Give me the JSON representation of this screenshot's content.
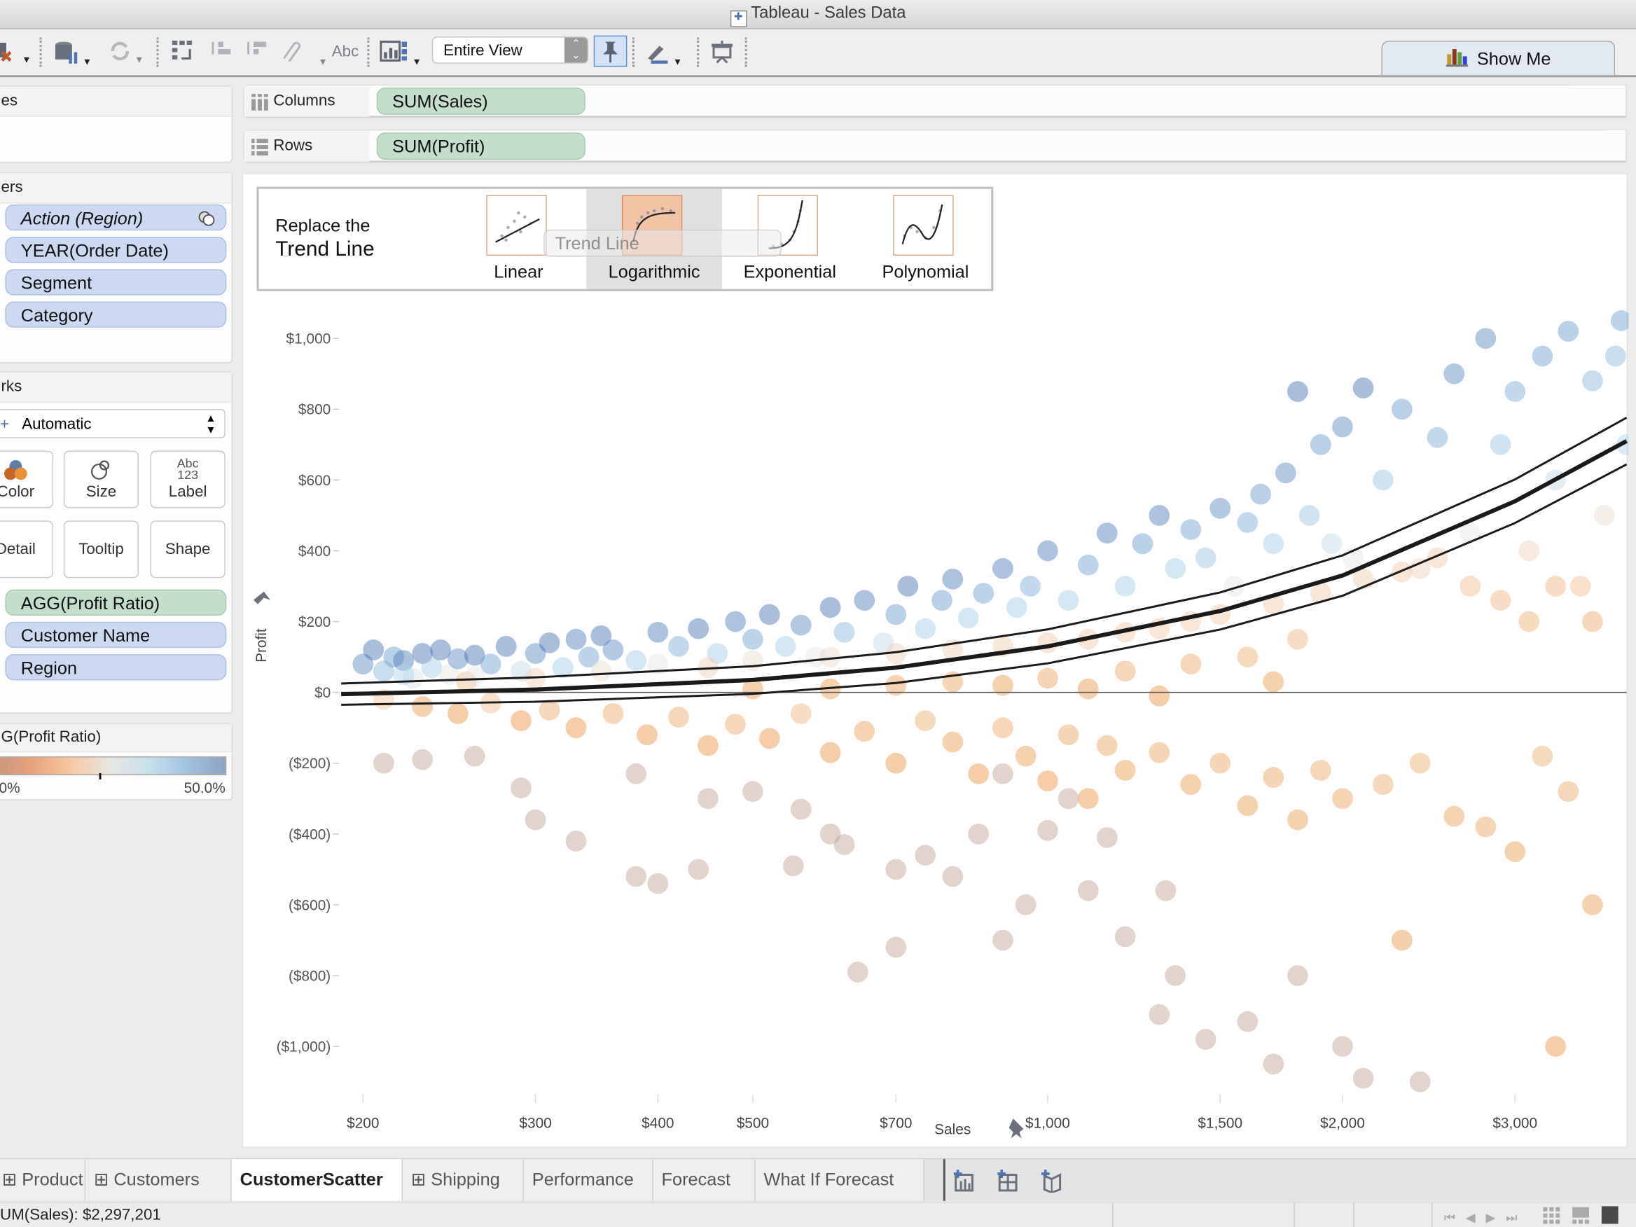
{
  "window": {
    "title": "Tableau - Sales Data"
  },
  "toolbar": {
    "fit_value": "Entire View",
    "label_button": "Abc",
    "show_me": "Show Me",
    "icons": [
      "clear-sheet-icon",
      "data-source-icon",
      "refresh-icon",
      "swap-axes-icon",
      "sort-ascending-icon",
      "sort-descending-icon",
      "group-icon",
      "show-labels-icon",
      "chart-type-icon",
      "pin-axis-icon",
      "highlight-pen-icon",
      "presentation-icon"
    ]
  },
  "panels": {
    "pages": {
      "title": "es"
    },
    "filters": {
      "title": "ers",
      "items": [
        "Action (Region)",
        "YEAR(Order Date)",
        "Segment",
        "Category"
      ]
    },
    "marks": {
      "title": "rks",
      "mark_type": "Automatic",
      "buttons": [
        "Color",
        "Size",
        "Label",
        "Detail",
        "Tooltip",
        "Shape"
      ],
      "label_glyph_top": "Abc",
      "label_glyph_bottom": "123",
      "fields": [
        {
          "label": "AGG(Profit Ratio)",
          "kind": "measure"
        },
        {
          "label": "Customer Name",
          "kind": "dimension"
        },
        {
          "label": "Region",
          "kind": "dimension"
        }
      ]
    },
    "legend": {
      "title": "G(Profit Ratio)",
      "min_label": "0%",
      "max_label": "50.0%",
      "colors": [
        "#c89680",
        "#e8a57a",
        "#f6caa4",
        "#e8e6e2",
        "#c6e1ee",
        "#9fc3e0",
        "#8ea3c3"
      ]
    }
  },
  "shelves": {
    "columns": {
      "label": "Columns",
      "pill": "SUM(Sales)"
    },
    "rows": {
      "label": "Rows",
      "pill": "SUM(Profit)"
    }
  },
  "trend_popup": {
    "title_line1": "Replace the",
    "title_line2": "Trend Line",
    "drag_label": "Trend Line",
    "options": [
      {
        "label": "Linear",
        "selected": false
      },
      {
        "label": "Logarithmic",
        "selected": true
      },
      {
        "label": "Exponential",
        "selected": false
      },
      {
        "label": "Polynomial",
        "selected": false
      }
    ]
  },
  "chart_data": {
    "type": "scatter",
    "title": "",
    "xlabel": "Sales",
    "ylabel": "Profit",
    "x_scale": "log",
    "xlim": [
      190,
      3900
    ],
    "ylim": [
      -1130,
      1110
    ],
    "x_ticks": [
      {
        "value": 200,
        "label": "$200"
      },
      {
        "value": 300,
        "label": "$300"
      },
      {
        "value": 400,
        "label": "$400"
      },
      {
        "value": 500,
        "label": "$500"
      },
      {
        "value": 700,
        "label": "$700"
      },
      {
        "value": 1000,
        "label": "$1,000"
      },
      {
        "value": 1500,
        "label": "$1,500"
      },
      {
        "value": 2000,
        "label": "$2,000"
      },
      {
        "value": 3000,
        "label": "$3,000"
      }
    ],
    "y_ticks": [
      {
        "value": 1000,
        "label": "$1,000"
      },
      {
        "value": 800,
        "label": "$800"
      },
      {
        "value": 600,
        "label": "$600"
      },
      {
        "value": 400,
        "label": "$400"
      },
      {
        "value": 200,
        "label": "$200"
      },
      {
        "value": 0,
        "label": "$0"
      },
      {
        "value": -200,
        "label": "($200)"
      },
      {
        "value": -400,
        "label": "($400)"
      },
      {
        "value": -600,
        "label": "($600)"
      },
      {
        "value": -800,
        "label": "($800)"
      },
      {
        "value": -1000,
        "label": "($1,000)"
      }
    ],
    "color_field": "AGG(Profit Ratio)",
    "color_range": [
      0,
      0.5
    ],
    "trend_line": {
      "model": "exponential-like",
      "points": [
        [
          190,
          -5
        ],
        [
          300,
          8
        ],
        [
          500,
          35
        ],
        [
          700,
          70
        ],
        [
          1000,
          130
        ],
        [
          1500,
          230
        ],
        [
          2000,
          330
        ],
        [
          3000,
          540
        ],
        [
          3900,
          710
        ]
      ],
      "band": 30
    },
    "points": [
      [
        200,
        80,
        0.45
      ],
      [
        205,
        120,
        0.5
      ],
      [
        210,
        60,
        0.35
      ],
      [
        215,
        100,
        0.42
      ],
      [
        220,
        90,
        0.48
      ],
      [
        225,
        40,
        0.22
      ],
      [
        230,
        110,
        0.5
      ],
      [
        235,
        70,
        0.3
      ],
      [
        240,
        120,
        0.5
      ],
      [
        245,
        50,
        0.2
      ],
      [
        250,
        95,
        0.45
      ],
      [
        255,
        30,
        0.1
      ],
      [
        260,
        105,
        0.5
      ],
      [
        270,
        80,
        0.4
      ],
      [
        280,
        130,
        0.5
      ],
      [
        290,
        60,
        0.25
      ],
      [
        300,
        110,
        0.45
      ],
      [
        310,
        140,
        0.5
      ],
      [
        320,
        70,
        0.3
      ],
      [
        330,
        150,
        0.48
      ],
      [
        340,
        100,
        0.4
      ],
      [
        350,
        160,
        0.5
      ],
      [
        360,
        120,
        0.45
      ],
      [
        380,
        90,
        0.3
      ],
      [
        400,
        170,
        0.48
      ],
      [
        420,
        130,
        0.38
      ],
      [
        440,
        180,
        0.5
      ],
      [
        460,
        110,
        0.3
      ],
      [
        480,
        200,
        0.48
      ],
      [
        500,
        150,
        0.4
      ],
      [
        520,
        220,
        0.5
      ],
      [
        540,
        130,
        0.3
      ],
      [
        560,
        190,
        0.45
      ],
      [
        580,
        100,
        0.2
      ],
      [
        600,
        240,
        0.5
      ],
      [
        620,
        170,
        0.35
      ],
      [
        650,
        260,
        0.48
      ],
      [
        680,
        140,
        0.25
      ],
      [
        700,
        220,
        0.42
      ],
      [
        720,
        300,
        0.5
      ],
      [
        750,
        180,
        0.3
      ],
      [
        780,
        260,
        0.42
      ],
      [
        800,
        320,
        0.48
      ],
      [
        830,
        210,
        0.3
      ],
      [
        860,
        280,
        0.4
      ],
      [
        900,
        350,
        0.48
      ],
      [
        930,
        240,
        0.3
      ],
      [
        960,
        300,
        0.38
      ],
      [
        1000,
        400,
        0.48
      ],
      [
        1050,
        260,
        0.3
      ],
      [
        1100,
        360,
        0.4
      ],
      [
        1150,
        450,
        0.48
      ],
      [
        1200,
        300,
        0.3
      ],
      [
        1250,
        420,
        0.42
      ],
      [
        1300,
        500,
        0.48
      ],
      [
        1350,
        350,
        0.3
      ],
      [
        1400,
        460,
        0.4
      ],
      [
        1450,
        380,
        0.32
      ],
      [
        1500,
        520,
        0.45
      ],
      [
        1550,
        300,
        0.2
      ],
      [
        1600,
        480,
        0.38
      ],
      [
        1650,
        560,
        0.42
      ],
      [
        1700,
        420,
        0.3
      ],
      [
        1750,
        620,
        0.45
      ],
      [
        1800,
        850,
        0.5
      ],
      [
        1850,
        500,
        0.32
      ],
      [
        1900,
        700,
        0.42
      ],
      [
        1950,
        420,
        0.25
      ],
      [
        2000,
        750,
        0.45
      ],
      [
        2050,
        380,
        0.2
      ],
      [
        2100,
        860,
        0.5
      ],
      [
        2200,
        600,
        0.32
      ],
      [
        2300,
        800,
        0.42
      ],
      [
        2400,
        350,
        0.15
      ],
      [
        2500,
        720,
        0.38
      ],
      [
        2600,
        900,
        0.45
      ],
      [
        2700,
        450,
        0.2
      ],
      [
        2800,
        1000,
        0.45
      ],
      [
        2900,
        700,
        0.32
      ],
      [
        3000,
        850,
        0.38
      ],
      [
        3100,
        400,
        0.15
      ],
      [
        3200,
        950,
        0.4
      ],
      [
        3300,
        600,
        0.25
      ],
      [
        3400,
        1020,
        0.42
      ],
      [
        3500,
        300,
        0.1
      ],
      [
        3600,
        880,
        0.35
      ],
      [
        3700,
        500,
        0.18
      ],
      [
        3800,
        950,
        0.35
      ],
      [
        3850,
        1050,
        0.4
      ],
      [
        3900,
        700,
        0.28
      ],
      [
        220,
        50,
        0.28
      ],
      [
        260,
        45,
        0.2
      ],
      [
        300,
        40,
        0.15
      ],
      [
        350,
        60,
        0.18
      ],
      [
        400,
        80,
        0.2
      ],
      [
        450,
        70,
        0.15
      ],
      [
        500,
        90,
        0.18
      ],
      [
        600,
        100,
        0.17
      ],
      [
        700,
        110,
        0.15
      ],
      [
        800,
        120,
        0.14
      ],
      [
        900,
        130,
        0.14
      ],
      [
        1000,
        140,
        0.13
      ],
      [
        1100,
        150,
        0.13
      ],
      [
        1200,
        170,
        0.13
      ],
      [
        1300,
        180,
        0.13
      ],
      [
        1400,
        200,
        0.13
      ],
      [
        1500,
        220,
        0.13
      ],
      [
        1700,
        250,
        0.13
      ],
      [
        1900,
        280,
        0.13
      ],
      [
        2100,
        320,
        0.14
      ],
      [
        2300,
        340,
        0.13
      ],
      [
        2500,
        380,
        0.13
      ],
      [
        2700,
        300,
        0.1
      ],
      [
        2900,
        260,
        0.08
      ],
      [
        3100,
        200,
        0.06
      ],
      [
        3300,
        300,
        0.08
      ],
      [
        3600,
        200,
        0.05
      ],
      [
        1800,
        150,
        0.08
      ],
      [
        1600,
        100,
        0.06
      ],
      [
        1400,
        80,
        0.05
      ],
      [
        1200,
        60,
        0.05
      ],
      [
        1000,
        40,
        0.04
      ],
      [
        900,
        20,
        0.02
      ],
      [
        800,
        30,
        0.04
      ],
      [
        700,
        20,
        0.03
      ],
      [
        600,
        10,
        0.02
      ],
      [
        500,
        10,
        0.02
      ],
      [
        1100,
        10,
        0.01
      ],
      [
        1300,
        -10,
        0.0
      ],
      [
        1700,
        30,
        0.02
      ],
      [
        210,
        -20,
        0.12
      ],
      [
        230,
        -40,
        0.02
      ],
      [
        250,
        -60,
        0.0
      ],
      [
        270,
        -30,
        0.1
      ],
      [
        290,
        -80,
        0.0
      ],
      [
        310,
        -50,
        0.05
      ],
      [
        330,
        -100,
        0.0
      ],
      [
        360,
        -60,
        0.05
      ],
      [
        390,
        -120,
        0.0
      ],
      [
        420,
        -70,
        0.05
      ],
      [
        450,
        -150,
        0.0
      ],
      [
        480,
        -90,
        0.05
      ],
      [
        520,
        -130,
        0.0
      ],
      [
        560,
        -60,
        0.08
      ],
      [
        600,
        -170,
        0.0
      ],
      [
        650,
        -110,
        0.03
      ],
      [
        700,
        -200,
        0.0
      ],
      [
        750,
        -80,
        0.06
      ],
      [
        800,
        -140,
        0.02
      ],
      [
        850,
        -230,
        0.0
      ],
      [
        900,
        -100,
        0.05
      ],
      [
        950,
        -180,
        0.02
      ],
      [
        1000,
        -250,
        0.0
      ],
      [
        1050,
        -120,
        0.04
      ],
      [
        1100,
        -300,
        0.0
      ],
      [
        1150,
        -150,
        0.04
      ],
      [
        1200,
        -220,
        0.02
      ],
      [
        1300,
        -170,
        0.04
      ],
      [
        1400,
        -260,
        0.02
      ],
      [
        1500,
        -200,
        0.04
      ],
      [
        1600,
        -320,
        0.02
      ],
      [
        1700,
        -240,
        0.04
      ],
      [
        1800,
        -360,
        0.02
      ],
      [
        1900,
        -220,
        0.05
      ],
      [
        2000,
        -300,
        0.03
      ],
      [
        2200,
        -260,
        0.05
      ],
      [
        2400,
        -200,
        0.06
      ],
      [
        2600,
        -350,
        0.03
      ],
      [
        2800,
        -380,
        0.04
      ],
      [
        3000,
        -450,
        0.02
      ],
      [
        3200,
        -180,
        0.06
      ],
      [
        3400,
        -280,
        0.05
      ],
      [
        3600,
        -600,
        0.02
      ],
      [
        2300,
        -700,
        0.01
      ],
      [
        3300,
        -1000,
        0.0
      ],
      [
        210,
        -200,
        -0.2
      ],
      [
        230,
        -190,
        -0.2
      ],
      [
        290,
        -270,
        -0.2
      ],
      [
        300,
        -360,
        -0.2
      ],
      [
        330,
        -420,
        -0.2
      ],
      [
        380,
        -520,
        -0.2
      ],
      [
        400,
        -540,
        -0.2
      ],
      [
        440,
        -500,
        -0.2
      ],
      [
        500,
        -280,
        -0.2
      ],
      [
        600,
        -400,
        -0.2
      ],
      [
        620,
        -430,
        -0.2
      ],
      [
        640,
        -790,
        -0.2
      ],
      [
        700,
        -720,
        -0.2
      ],
      [
        750,
        -460,
        -0.2
      ],
      [
        800,
        -520,
        -0.2
      ],
      [
        850,
        -400,
        -0.2
      ],
      [
        900,
        -700,
        -0.2
      ],
      [
        950,
        -600,
        -0.2
      ],
      [
        1000,
        -390,
        -0.2
      ],
      [
        1100,
        -560,
        -0.2
      ],
      [
        1200,
        -690,
        -0.2
      ],
      [
        1300,
        -910,
        -0.2
      ],
      [
        1350,
        -800,
        -0.2
      ],
      [
        1450,
        -980,
        -0.2
      ],
      [
        1600,
        -930,
        -0.2
      ],
      [
        1700,
        -1050,
        -0.2
      ],
      [
        1800,
        -800,
        -0.2
      ],
      [
        2000,
        -1000,
        -0.2
      ],
      [
        2100,
        -1090,
        -0.2
      ],
      [
        2400,
        -1100,
        -0.2
      ],
      [
        550,
        -490,
        -0.2
      ],
      [
        700,
        -500,
        -0.2
      ],
      [
        560,
        -330,
        -0.2
      ],
      [
        450,
        -300,
        -0.2
      ],
      [
        380,
        -230,
        -0.2
      ],
      [
        260,
        -180,
        -0.2
      ],
      [
        900,
        -230,
        -0.2
      ],
      [
        1050,
        -300,
        -0.2
      ],
      [
        1150,
        -410,
        -0.2
      ],
      [
        1320,
        -560,
        -0.2
      ]
    ]
  },
  "tabs": {
    "items": [
      {
        "label": "Product",
        "icon": "grid",
        "active": false
      },
      {
        "label": "Customers",
        "icon": "grid",
        "active": false
      },
      {
        "label": "CustomerScatter",
        "icon": "",
        "active": true
      },
      {
        "label": "Shipping",
        "icon": "grid",
        "active": false
      },
      {
        "label": "Performance",
        "icon": "",
        "active": false
      },
      {
        "label": "Forecast",
        "icon": "",
        "active": false
      },
      {
        "label": "What If Forecast",
        "icon": "",
        "active": false
      }
    ]
  },
  "status": {
    "text": "UM(Sales): $2,297,201"
  }
}
